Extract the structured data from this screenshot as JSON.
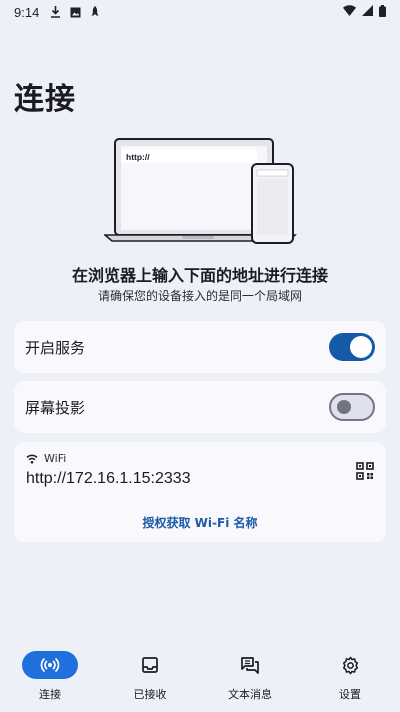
{
  "status_bar": {
    "time": "9:14"
  },
  "title": "连接",
  "illustration": {
    "browser_url": "http://"
  },
  "headline": "在浏览器上输入下面的地址进行连接",
  "subline": "请确保您的设备接入的是同一个局域网",
  "toggles": [
    {
      "label": "开启服务",
      "state": "on"
    },
    {
      "label": "屏幕投影",
      "state": "off"
    }
  ],
  "wifi": {
    "label": "WiFi",
    "address": "http://172.16.1.15:2333",
    "auth_link": "授权获取 Wi-Fi 名称"
  },
  "nav": [
    {
      "label": "连接",
      "icon": "connect-icon",
      "active": true
    },
    {
      "label": "已接收",
      "icon": "inbox-icon",
      "active": false
    },
    {
      "label": "文本消息",
      "icon": "chat-icon",
      "active": false
    },
    {
      "label": "设置",
      "icon": "gear-icon",
      "active": false
    }
  ],
  "colors": {
    "accent": "#155aa8",
    "nav_active": "#1f6fdc",
    "background": "#eef0f8",
    "card": "#f8f8fd"
  }
}
